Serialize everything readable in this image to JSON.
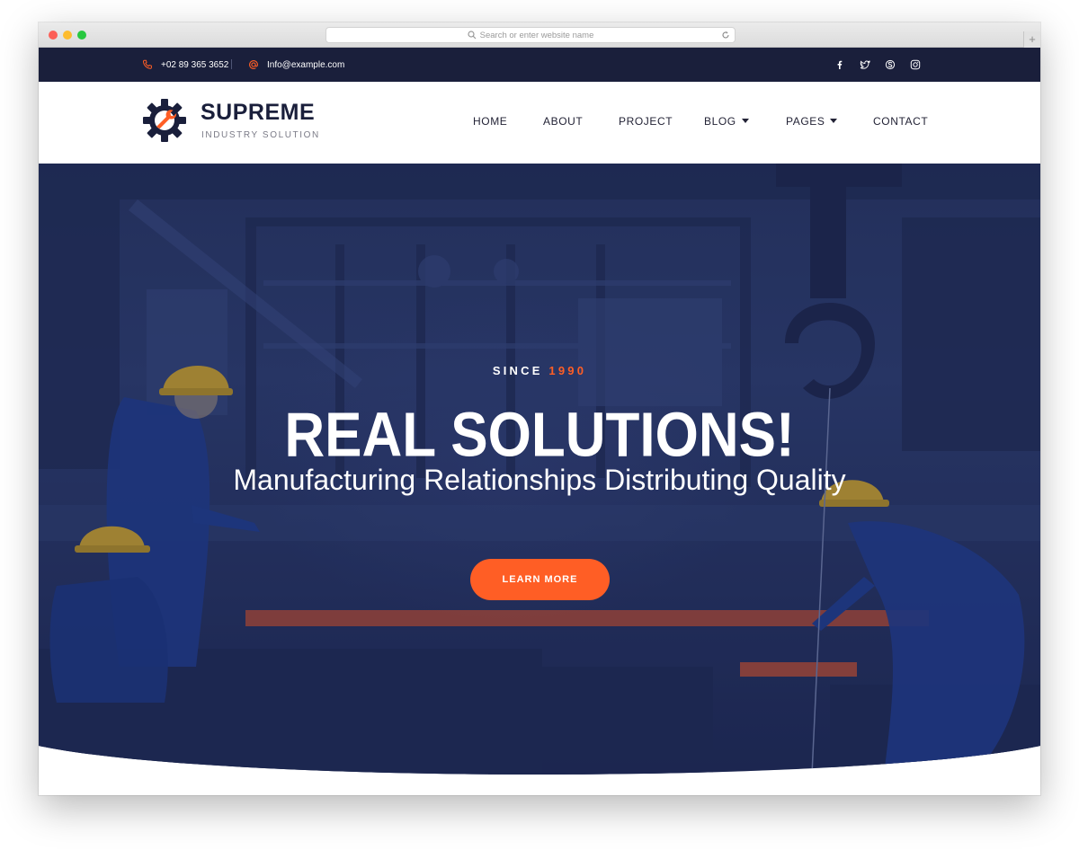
{
  "browser": {
    "address_placeholder": "Search or enter website name",
    "new_tab_label": "+"
  },
  "topbar": {
    "phone": "+02 89 365 3652",
    "email": "Info@example.com",
    "separator": "|",
    "social_icons": [
      "facebook-icon",
      "twitter-icon",
      "skype-icon",
      "instagram-icon"
    ]
  },
  "header": {
    "logo_name": "SUPREME",
    "logo_tagline": "INDUSTRY SOLUTION",
    "nav": {
      "home": "HOME",
      "about": "ABOUT",
      "project": "PROJECT",
      "blog": "BLOG",
      "pages": "PAGES",
      "contact": "CONTACT"
    }
  },
  "hero": {
    "since_label": "SINCE",
    "since_year": "1990",
    "headline": "REAL SOLUTIONS!",
    "subheadline": "Manufacturing Relationships Distributing Quality",
    "cta_label": "LEARN MORE"
  },
  "colors": {
    "navy": "#1a1f3b",
    "accent": "#ff5e25",
    "hero_overlay": "#26345f",
    "white": "#ffffff"
  }
}
